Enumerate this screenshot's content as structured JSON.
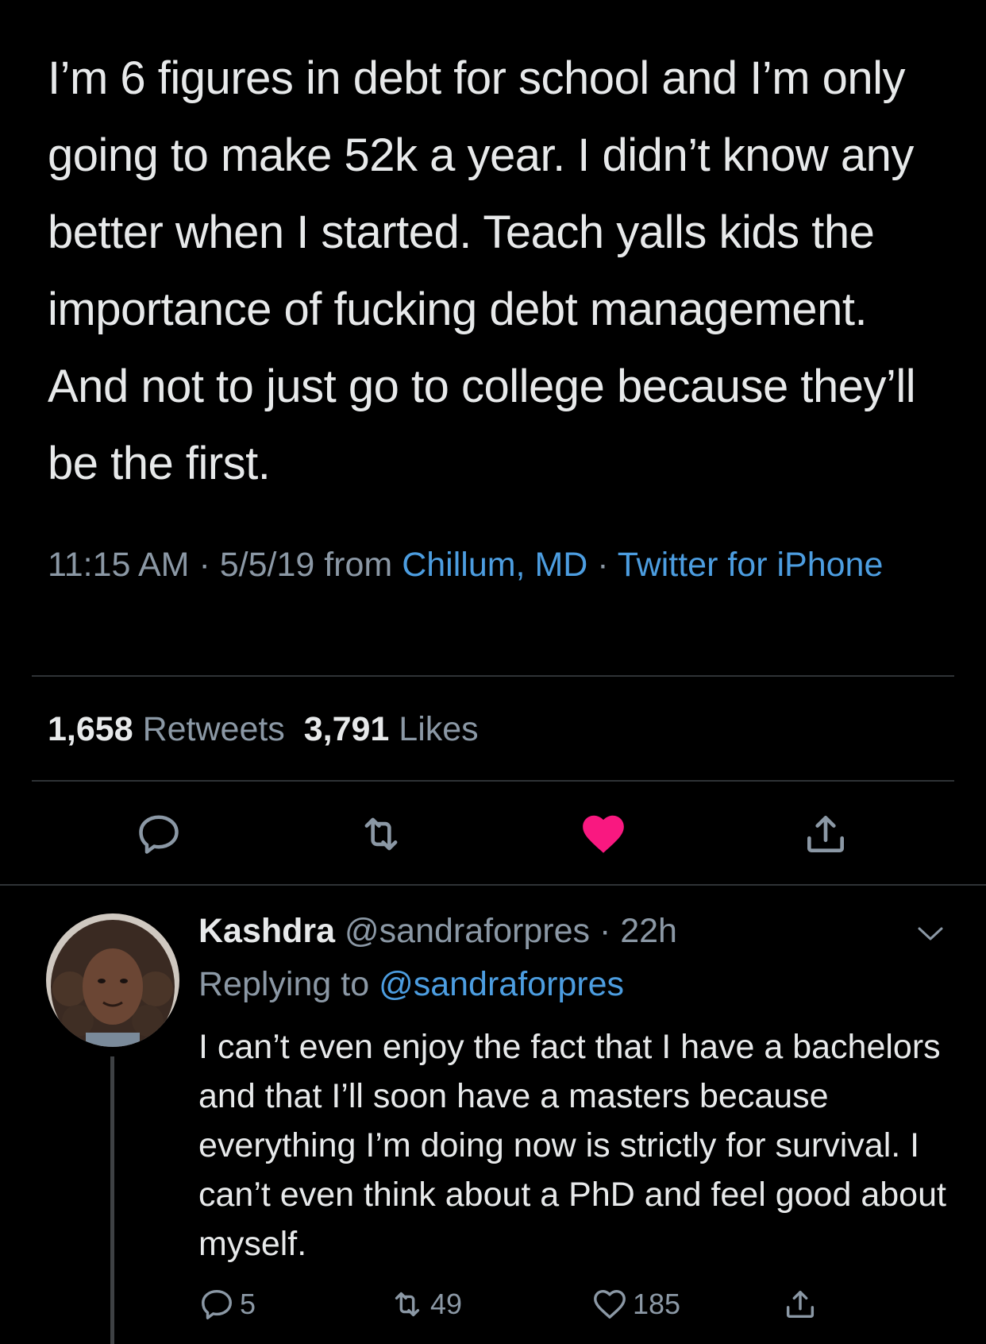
{
  "main_tweet": {
    "text": "I’m 6 figures in debt for school and I’m only going to make 52k a year. I didn’t know any better when I started. Teach yalls kids the importance of fucking debt management. And not to just go to college because they’ll be the first.",
    "time": "11:15 AM",
    "sep1": " · ",
    "date": "5/5/19",
    "from": " from ",
    "location": "Chillum, MD",
    "sep2": " · ",
    "source": "Twitter for iPhone",
    "retweets_count": "1,658",
    "retweets_label": "Retweets",
    "likes_count": "3,791",
    "likes_label": "Likes",
    "liked": true
  },
  "reply": {
    "name": "Kashdra",
    "handle": "@sandraforpres",
    "separator": " · ",
    "time": "22h",
    "replying_prefix": "Replying to ",
    "replying_to": "@sandraforpres",
    "text": "I can’t even enjoy the fact that I have a bachelors and that I’ll soon have a masters because everything I’m doing now is strictly for survival. I can’t even think about a PhD and feel good about myself.",
    "reply_count": "5",
    "retweet_count": "49",
    "like_count": "185"
  },
  "colors": {
    "background": "#000000",
    "text": "#e7e9ea",
    "secondary": "#8b98a5",
    "link": "#4c9de0",
    "like": "#f91880",
    "divider": "#2f3336"
  },
  "icons": [
    "reply-icon",
    "retweet-icon",
    "heart-icon",
    "share-icon",
    "chevron-down-icon"
  ]
}
